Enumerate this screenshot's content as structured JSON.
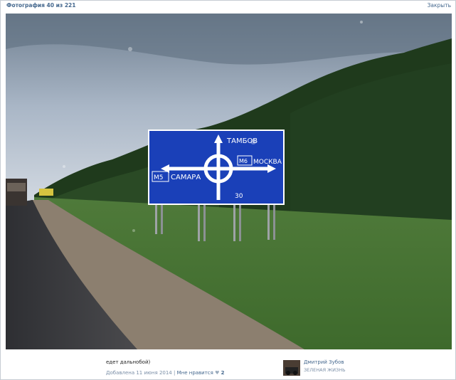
{
  "viewer": {
    "counter": "Фотография 40 из 221",
    "close_label": "Закрыть"
  },
  "photo": {
    "sign": {
      "top": "ТАМБОВ",
      "left_route": "М5",
      "left": "САМАРА",
      "right_route": "М6",
      "right": "МОСКВА",
      "bottom": "30"
    }
  },
  "info": {
    "caption": "едет дальнобой)",
    "added": "Добавлена 11 июня 2014",
    "separator": "|",
    "like_label": "Мне нравится",
    "heart": "♥",
    "likes": "2"
  },
  "author": {
    "name": "Дмитрий Зубов",
    "subtitle": "ЗЕЛЕНАЯ ЖИЗНЬ"
  },
  "colors": {
    "link": "#45688e",
    "sign_blue": "#1a40b8"
  }
}
